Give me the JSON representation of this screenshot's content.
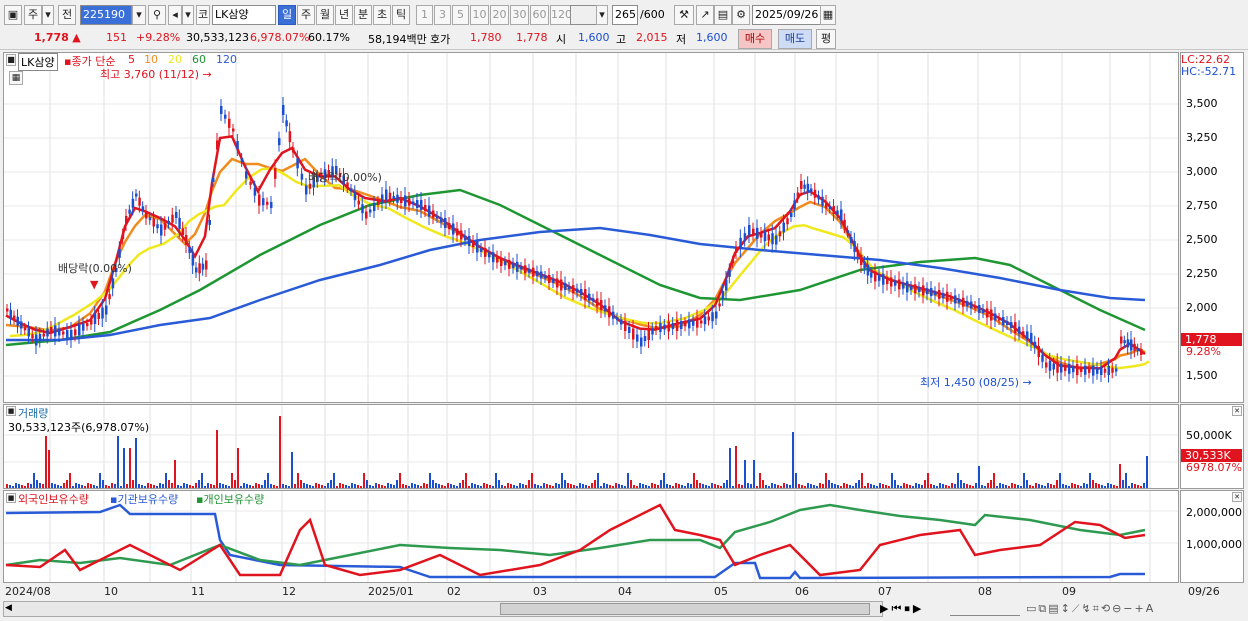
{
  "toolbar": {
    "type_label": "주",
    "prev_label": "전",
    "code": "225190",
    "name": "LK삼양",
    "periods": [
      "일",
      "주",
      "월",
      "년",
      "분",
      "초",
      "틱"
    ],
    "intervals": [
      "1",
      "3",
      "5",
      "10",
      "20",
      "30",
      "60",
      "120"
    ],
    "count": "265",
    "count_total": "/600",
    "date": "2025/09/26"
  },
  "info": {
    "price": "1,778",
    "change": "151",
    "pct": "+9.28%",
    "volume": "30,533,123",
    "vol_pct": "6,978.07%",
    "turnover": "60.17%",
    "amount": "58,194백만",
    "hoga_label": "호가",
    "ask": "1,780",
    "bid": "1,778",
    "open_label": "시",
    "open": "1,600",
    "high_label": "고",
    "high": "2,015",
    "low_label": "저",
    "low": "1,600",
    "buy": "매수",
    "sell": "매도",
    "eval": "평"
  },
  "price_panel": {
    "legend_name": "LK삼양",
    "legend_type": "종가 단순",
    "ma": [
      "5",
      "10",
      "20",
      "60",
      "120"
    ],
    "ma_colors": [
      "#e0141e",
      "#f08c1e",
      "#f0e81e",
      "#1e9632",
      "#2a5bd7"
    ],
    "max_label": "최고 3,760 (11/12)",
    "min_label": "최저 1,450 (08/25)",
    "div_label": "배당락(0.00%)",
    "div_label2": "배당락(0.00%)",
    "lc": "LC:22.62",
    "hc": "HC:-52.71",
    "last": "1,778",
    "last_pct": "9.28%",
    "yticks": [
      "3,500",
      "3,250",
      "3,000",
      "2,750",
      "2,500",
      "2,250",
      "2,000",
      "1,750",
      "1,500"
    ]
  },
  "volume_panel": {
    "title": "거래량",
    "value": "30,533,123주(6,978.07%)",
    "ytick": "50,000K",
    "last": "30,533K",
    "last_pct": "6978.07%"
  },
  "holding_panel": {
    "legend": [
      "외국인보유수량",
      "기관보유수량",
      "개인보유수량"
    ],
    "yticks": [
      "2,000,000",
      "1,000,000"
    ]
  },
  "xaxis": [
    "2024/08",
    "10",
    "11",
    "12",
    "2025/01",
    "02",
    "03",
    "04",
    "05",
    "06",
    "07",
    "08",
    "09",
    "09/26"
  ]
}
